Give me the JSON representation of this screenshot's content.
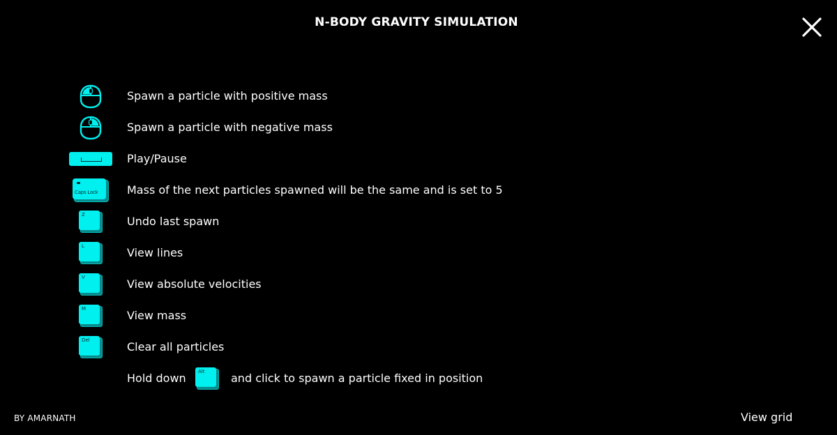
{
  "header": {
    "title": "N-BODY GRAVITY SIMULATION",
    "close_icon": "close-icon"
  },
  "accent_color": "#00F0F0",
  "background_color": "#000000",
  "controls": [
    {
      "icon": "mouse-left-click-icon",
      "label": "Spawn a particle with positive mass"
    },
    {
      "icon": "mouse-right-click-icon",
      "label": "Spawn a particle with negative mass"
    },
    {
      "icon": "spacebar-key-icon",
      "label": "Play/Pause"
    },
    {
      "icon": "caps-lock-key-icon",
      "key": "Caps Lock",
      "label": "Mass of the next particles spawned will be the same and is set to 5"
    },
    {
      "icon": "z-key-icon",
      "key": "Z",
      "label": "Undo last spawn"
    },
    {
      "icon": "l-key-icon",
      "key": "L",
      "label": "View lines"
    },
    {
      "icon": "v-key-icon",
      "key": "V",
      "label": "View absolute velocities"
    },
    {
      "icon": "m-key-icon",
      "key": "M",
      "label": "View mass"
    },
    {
      "icon": "del-key-icon",
      "key": "Del",
      "label": "Clear all particles"
    }
  ],
  "hold_instruction": {
    "before": "Hold down",
    "key": "Alt",
    "icon": "alt-key-icon",
    "after": "and click to spawn a particle fixed in position"
  },
  "footer": {
    "credit": "BY AMARNATH",
    "view_grid_label": "View grid"
  }
}
